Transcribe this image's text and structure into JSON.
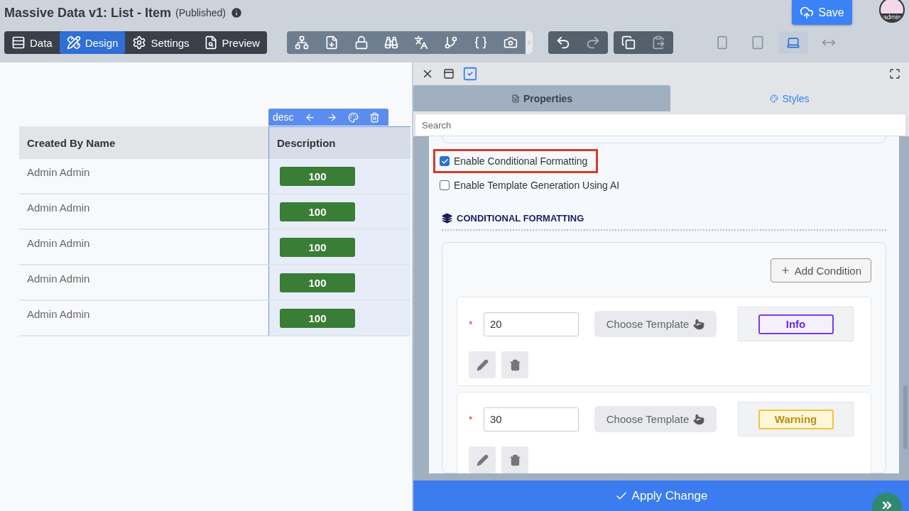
{
  "header": {
    "title": "Massive Data v1: List - Item",
    "status": "(Published)"
  },
  "mode_tabs": [
    {
      "label": "Data",
      "kind": "data",
      "selected": false
    },
    {
      "label": "Design",
      "kind": "design",
      "selected": true
    },
    {
      "label": "Settings",
      "kind": "settings",
      "selected": false
    },
    {
      "label": "Preview",
      "kind": "preview",
      "selected": false
    }
  ],
  "save_button": {
    "label": "Save"
  },
  "avatar": {
    "label": "admin"
  },
  "devices": [
    {
      "kind": "phone",
      "selected": false
    },
    {
      "kind": "tablet",
      "selected": false
    },
    {
      "kind": "laptop",
      "selected": true
    },
    {
      "kind": "full",
      "selected": false
    }
  ],
  "table": {
    "column_toolbar": {
      "label": "desc"
    },
    "columns": [
      "Created By Name",
      "Description"
    ],
    "rows": [
      {
        "name": "Admin Admin",
        "value": "100"
      },
      {
        "name": "Admin Admin",
        "value": "100"
      },
      {
        "name": "Admin Admin",
        "value": "100"
      },
      {
        "name": "Admin Admin",
        "value": "100"
      },
      {
        "name": "Admin Admin",
        "value": "100"
      }
    ]
  },
  "panel": {
    "tabs": [
      {
        "label": "Properties",
        "kind": "properties",
        "selected": true
      },
      {
        "label": "Styles",
        "kind": "styles",
        "selected": false
      }
    ],
    "search": {
      "placeholder": "Search"
    },
    "options": [
      {
        "label": "Enable Conditional Formatting",
        "checked": true,
        "highlighted": true
      },
      {
        "label": "Enable Template Generation Using AI",
        "checked": false,
        "highlighted": false
      }
    ],
    "section_title": "CONDITIONAL FORMATTING",
    "add_button": "Add Condition",
    "conditions": [
      {
        "required_mark": "*",
        "value": "20",
        "template_button": "Choose Template",
        "preview": {
          "label": "Info",
          "kind": "info"
        }
      },
      {
        "required_mark": "*",
        "value": "30",
        "template_button": "Choose Template",
        "preview": {
          "label": "Warning",
          "kind": "warning"
        }
      }
    ],
    "apply_button": "Apply Change"
  }
}
